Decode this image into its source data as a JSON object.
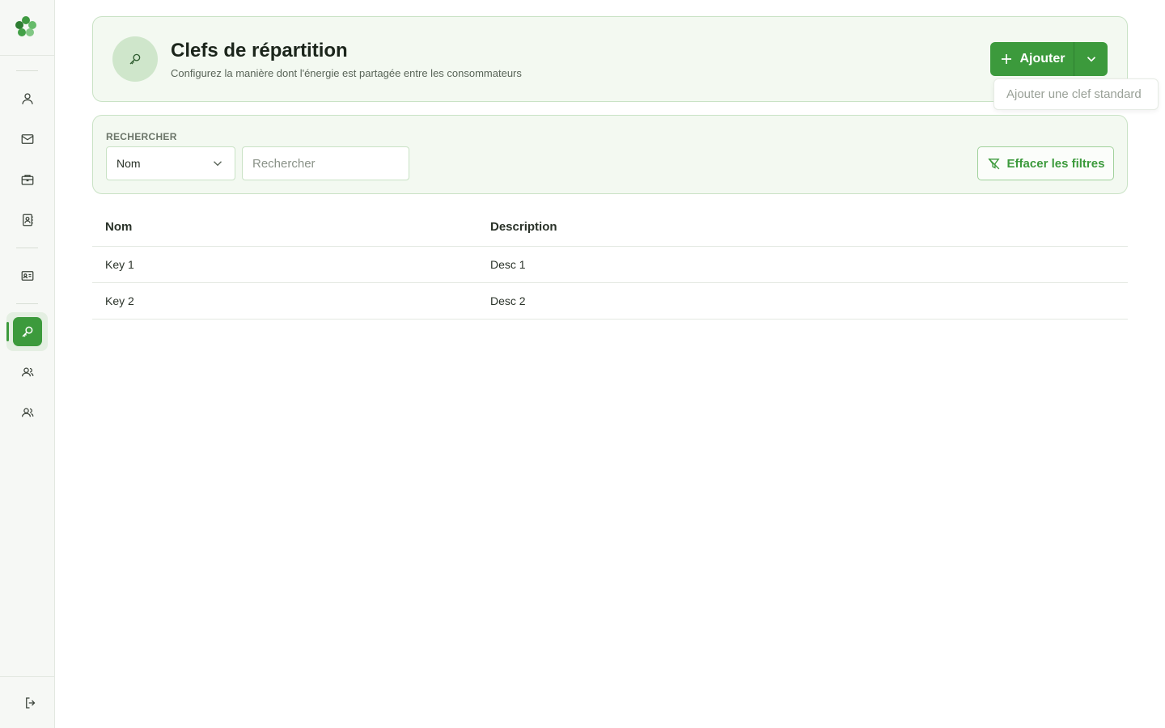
{
  "sidebar": {
    "logo_icon": "clover-logo-icon",
    "items": [
      {
        "icon": "user-icon"
      },
      {
        "icon": "mail-icon"
      },
      {
        "icon": "briefcase-icon"
      },
      {
        "icon": "contact-book-icon"
      },
      {
        "icon": "id-card-icon"
      },
      {
        "icon": "key-icon",
        "active": true
      },
      {
        "icon": "users-icon"
      },
      {
        "icon": "users-icon"
      }
    ],
    "logout_icon": "logout-icon"
  },
  "header": {
    "title": "Clefs de répartition",
    "subtitle": "Configurez la manière dont l'énergie est partagée entre les consommateurs",
    "add_label": "Ajouter",
    "dropdown_item": "Ajouter une clef standard"
  },
  "filters": {
    "label": "RECHERCHER",
    "field_select_value": "Nom",
    "search_placeholder": "Rechercher",
    "clear_label": "Effacer les filtres"
  },
  "table": {
    "columns": [
      "Nom",
      "Description"
    ],
    "rows": [
      {
        "name": "Key 1",
        "description": "Desc 1"
      },
      {
        "name": "Key 2",
        "description": "Desc 2"
      }
    ]
  },
  "colors": {
    "accent": "#3c9a3c",
    "card_bg": "#f3f9f1",
    "card_border": "#c9e2c5"
  }
}
